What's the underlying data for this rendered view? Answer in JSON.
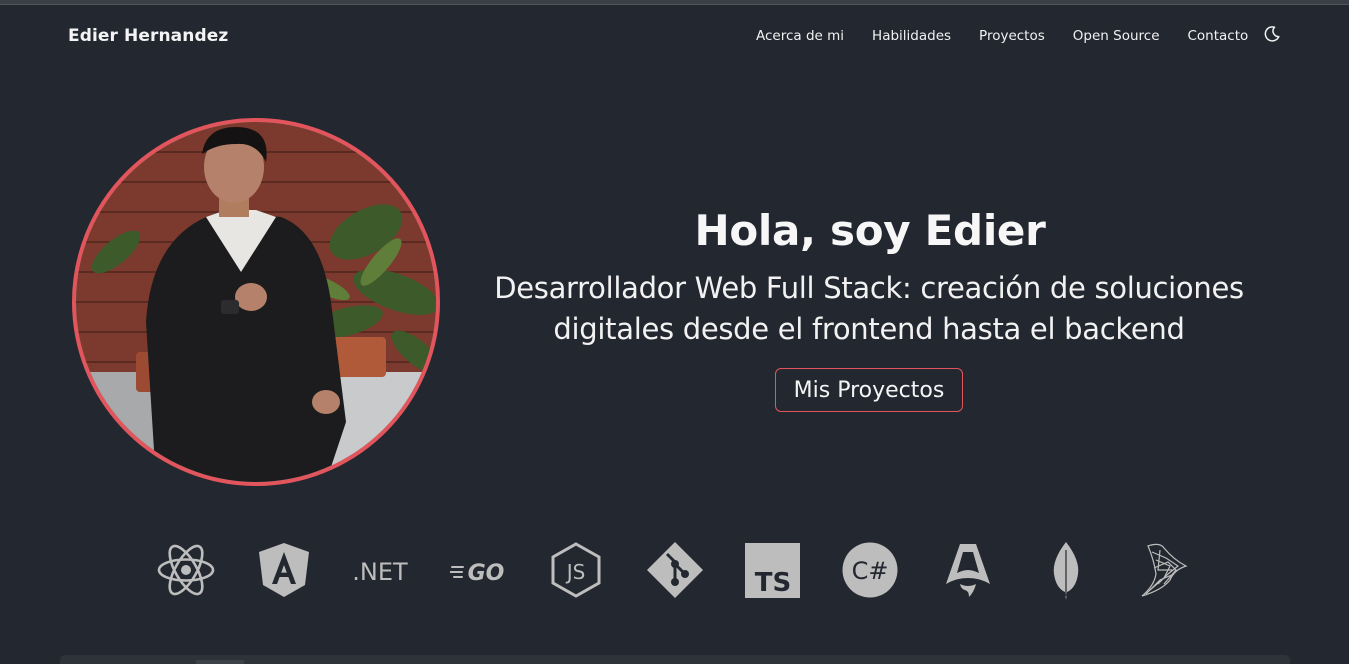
{
  "navbar": {
    "brand": "Edier Hernandez",
    "links": [
      "Acerca de mi",
      "Habilidades",
      "Proyectos",
      "Open Source",
      "Contacto"
    ],
    "theme_icon": "moon-icon"
  },
  "hero": {
    "title": "Hola, soy Edier",
    "subtitle_line1": "Desarrollador Web Full Stack: creación de soluciones",
    "subtitle_line2": "digitales desde el frontend hasta el backend",
    "button_label": "Mis Proyectos",
    "accent_color": "#e2555c"
  },
  "tech_icons": {
    "items": [
      "react-icon",
      "angular-icon",
      "dotnet-icon",
      "go-icon",
      "nodejs-icon",
      "git-icon",
      "typescript-icon",
      "csharp-icon",
      "astro-icon",
      "mongodb-icon",
      "sql-server-icon"
    ],
    "dotnet_text": ".NET",
    "go_text": "GO",
    "js_text": "JS",
    "ts_text": "TS",
    "csharp_text": "C#",
    "color": "#bdbdbd"
  }
}
